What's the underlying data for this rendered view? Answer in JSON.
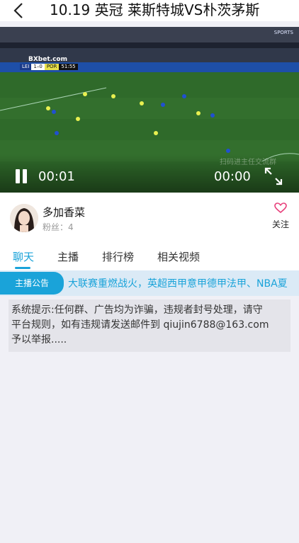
{
  "header": {
    "title": "10.19 英冠 莱斯特城VS朴茨茅斯"
  },
  "video": {
    "current_time": "00:01",
    "total_time": "00:00",
    "scorebug": {
      "home": "LEI",
      "score": "1–0",
      "away": "POR",
      "clock": "51:55"
    },
    "ad_text": "BXbet.com",
    "watermark": "扫码进主任交流群"
  },
  "anchor": {
    "name": "多加香菜",
    "fans_label": "粉丝：",
    "fans_count": "4",
    "follow_label": "关注"
  },
  "tabs": [
    {
      "label": "聊天",
      "active": true
    },
    {
      "label": "主播",
      "active": false
    },
    {
      "label": "排行榜",
      "active": false
    },
    {
      "label": "相关视频",
      "active": false
    }
  ],
  "notice": {
    "badge": "主播公告",
    "text": "大联赛重燃战火，英超西甲意甲德甲法甲、NBA夏"
  },
  "system_message": {
    "line1": "系统提示:任何群、广告均为诈骗，违规者封号处理，请守",
    "line2": "平台规则，如有违规请发送邮件到 qiujin6788@163.com",
    "line3": "予以举报....."
  },
  "colors": {
    "accent": "#1aa3d9",
    "follow_heart": "#e8417c"
  }
}
